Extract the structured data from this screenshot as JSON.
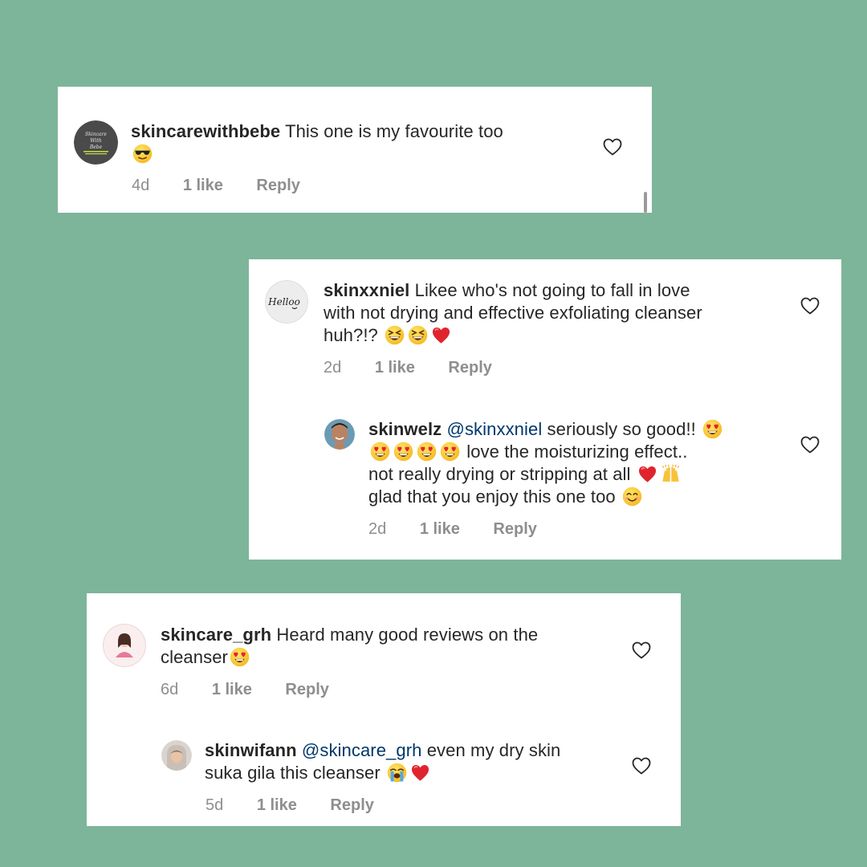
{
  "comments": [
    {
      "username": "skincarewithbebe",
      "text": "This one is my favourite too",
      "emojis": [
        "smiling-face-with-sunglasses"
      ],
      "time": "4d",
      "likes": "1 like",
      "reply": "Reply",
      "avatar_text": [
        "Skincare",
        "With",
        "Bebe"
      ],
      "avatar_color": "#4a4a4a"
    },
    {
      "username": "skinxxniel",
      "text_line1": "Likee who's not going to fall in love",
      "text_line2": "with not drying and effective exfoliating cleanser",
      "text_line3": "huh?!?",
      "emojis": [
        "grinning-squinting-face",
        "grinning-squinting-face",
        "red-heart"
      ],
      "time": "2d",
      "likes": "1 like",
      "reply": "Reply",
      "avatar_text": "Helloo"
    },
    {
      "username": "skinwelz",
      "mention": "@skinxxniel",
      "text_line1": "seriously so good!!",
      "text_line2": "love the moisturizing effect..",
      "text_line3": "not really drying or stripping at all",
      "text_line4": "glad that you enjoy this one too",
      "emojis": [
        "heart-eyes",
        "heart-eyes",
        "heart-eyes",
        "heart-eyes",
        "heart-eyes",
        "red-heart",
        "raising-hands",
        "smiling-face"
      ],
      "time": "2d",
      "likes": "1 like",
      "reply": "Reply"
    },
    {
      "username": "skincare_grh",
      "text_line1": "Heard many good reviews on the",
      "text_line2": "cleanser",
      "emojis": [
        "heart-eyes"
      ],
      "time": "6d",
      "likes": "1 like",
      "reply": "Reply"
    },
    {
      "username": "skinwifann",
      "mention": "@skincare_grh",
      "text_line1": "even my dry skin",
      "text_line2": "suka gila this cleanser",
      "emojis": [
        "loudly-crying-face",
        "red-heart"
      ],
      "time": "5d",
      "likes": "1 like",
      "reply": "Reply"
    }
  ],
  "colors": {
    "background": "#7db59a",
    "card": "#ffffff",
    "text": "#262626",
    "meta": "#8e8e8e",
    "mention": "#00376b",
    "heart_emoji": "#e0242e"
  }
}
